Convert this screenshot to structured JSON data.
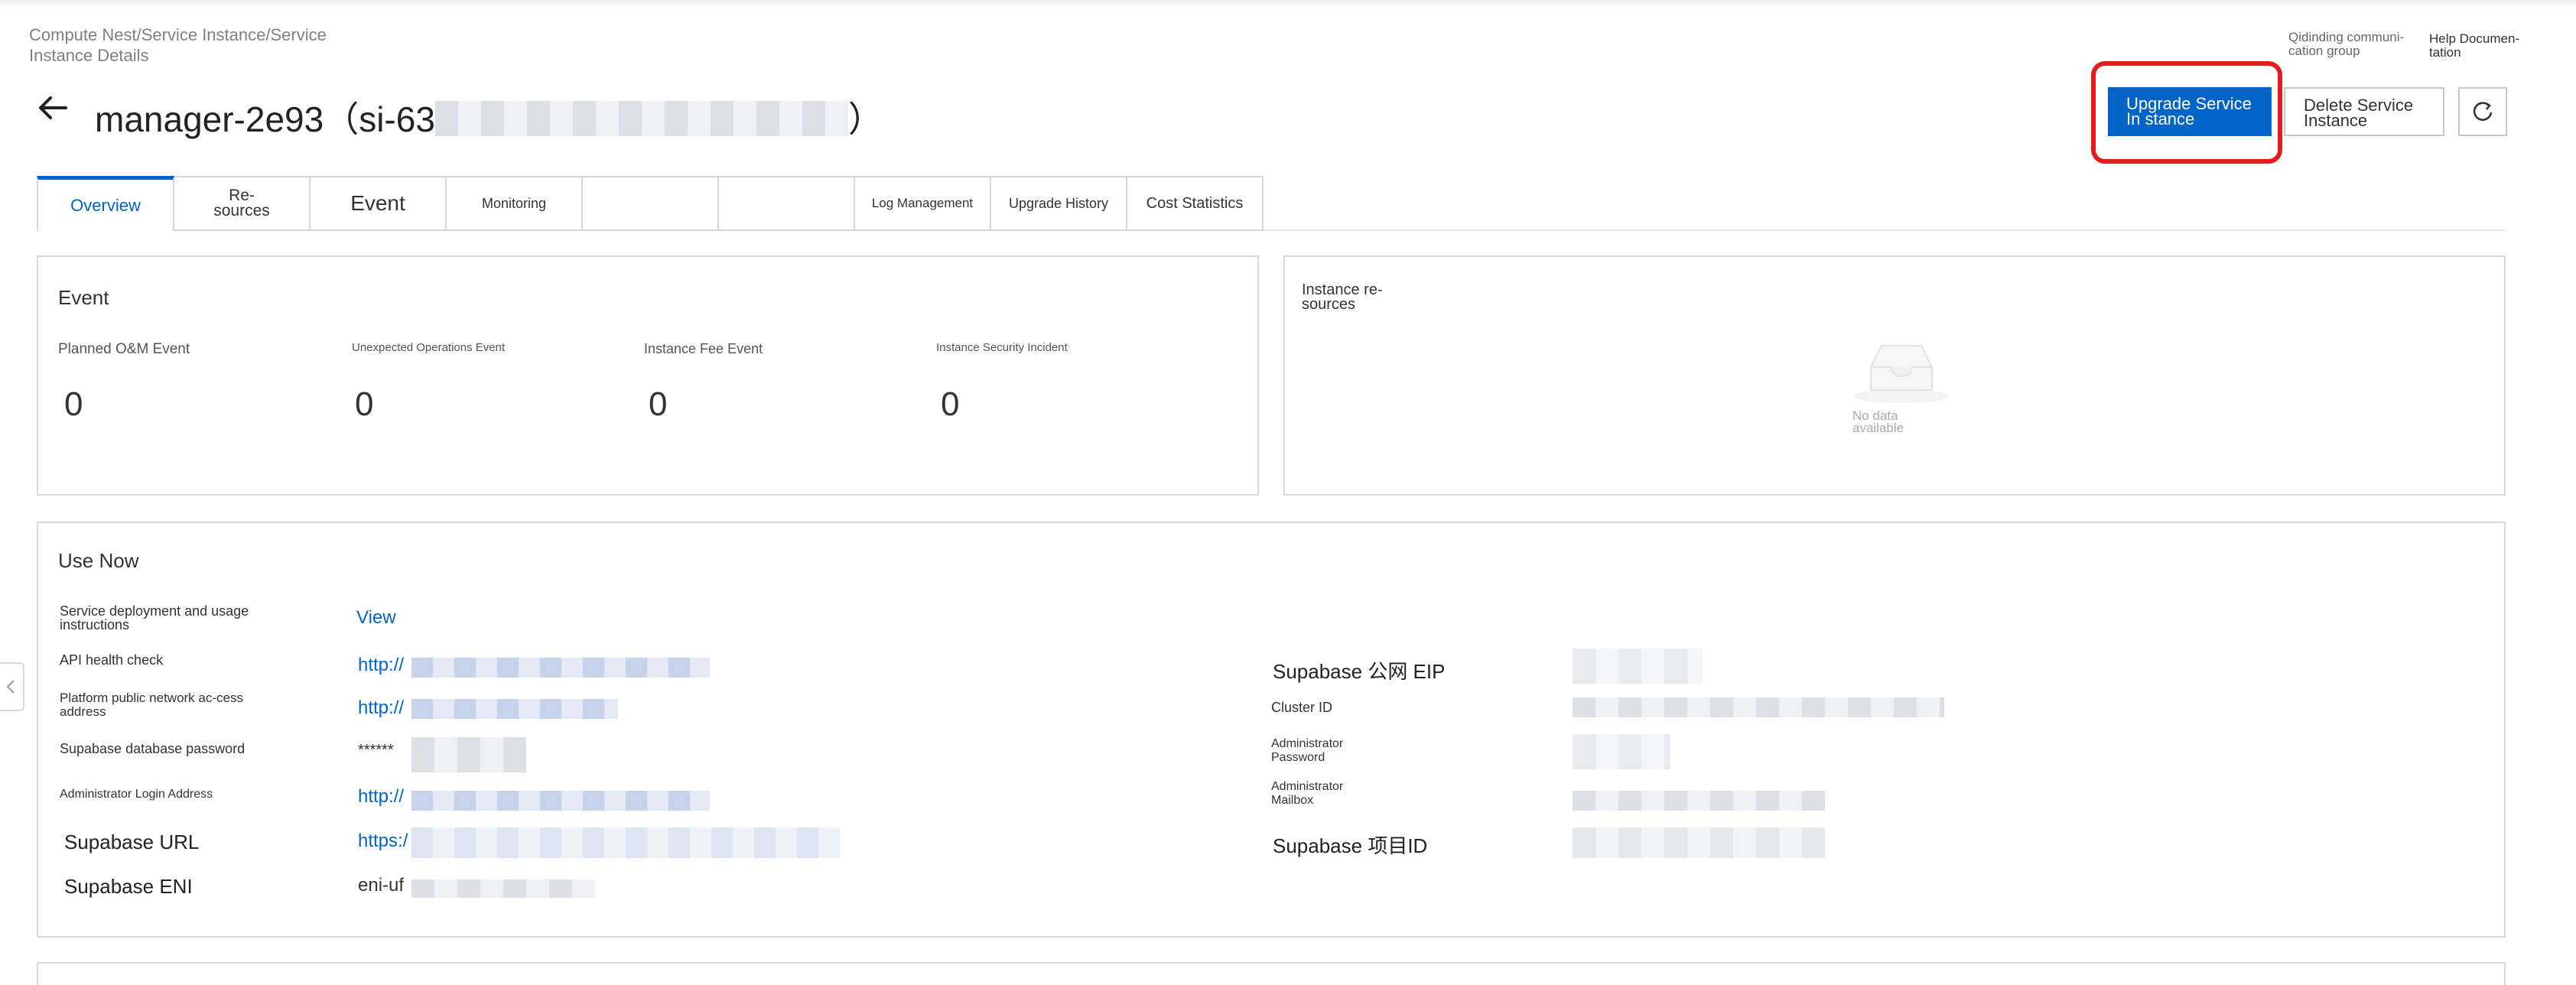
{
  "breadcrumb": "Compute Nest/Service Instance/Service Instance Details",
  "title": {
    "name": "manager-2e93",
    "id_prefix": "（si-63",
    "id_suffix": "）"
  },
  "header_links": {
    "dingtalk": "Qidinding communi-cation group",
    "help": "Help Documen-tation"
  },
  "actions": {
    "upgrade": "Upgrade Service In stance",
    "delete": "Delete Service Instance"
  },
  "tabs": [
    "Overview",
    "Re-sources",
    "Event",
    "Monitoring",
    "",
    "",
    "Log Management",
    "Upgrade History",
    "Cost Statistics"
  ],
  "event_card": {
    "title": "Event",
    "metrics": [
      {
        "label": "Planned O&M Event",
        "value": "0"
      },
      {
        "label": "Unexpected Operations Event",
        "value": "0"
      },
      {
        "label": "Instance Fee Event",
        "value": "0"
      },
      {
        "label": "Instance Security Incident",
        "value": "0"
      }
    ]
  },
  "resources_card": {
    "title": "Instance re-sources",
    "empty": "No data available"
  },
  "use_now": {
    "title": "Use Now",
    "deploy_label": "Service deployment and usage instructions",
    "deploy_link": "View",
    "left": [
      {
        "label": "API health check",
        "value": "http://"
      },
      {
        "label": "Platform public network ac-cess address",
        "value": "http://"
      },
      {
        "label": "Supabase database password",
        "value": "******"
      },
      {
        "label": "Administrator Login Address",
        "value": "http://"
      },
      {
        "label": "Supabase URL",
        "value": "https:/"
      },
      {
        "label": "Supabase ENI",
        "value": "eni-uf"
      }
    ],
    "right": [
      {
        "label": "Supabase 公网 EIP"
      },
      {
        "label": "Cluster ID"
      },
      {
        "label": "Administrator Password"
      },
      {
        "label": "Administrator Mailbox"
      },
      {
        "label": "Supabase 项目ID"
      }
    ]
  }
}
